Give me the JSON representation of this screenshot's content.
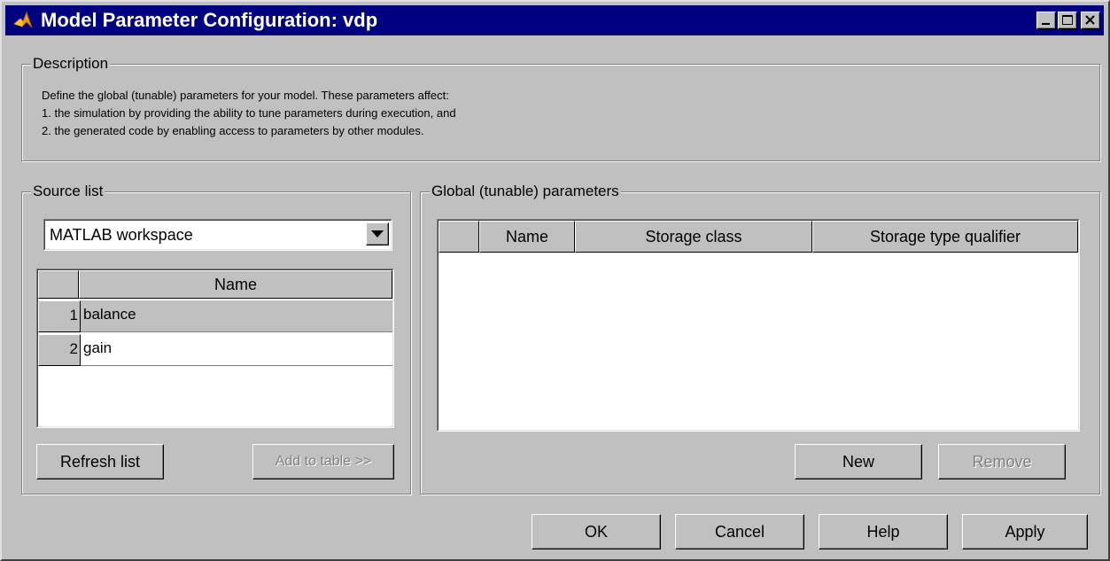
{
  "window": {
    "title": "Model Parameter Configuration: vdp"
  },
  "description": {
    "legend": "Description",
    "lines": [
      "Define the global (tunable) parameters for your model. These parameters affect:",
      "1. the simulation by providing the ability to tune parameters during execution, and",
      "2. the generated code by enabling access to parameters by other modules."
    ]
  },
  "source_list": {
    "legend": "Source list",
    "selected_source": "MATLAB workspace",
    "table": {
      "column_header": "Name",
      "rows": [
        {
          "index": "1",
          "name": "balance"
        },
        {
          "index": "2",
          "name": "gain"
        }
      ]
    },
    "refresh_label": "Refresh list",
    "add_label": "Add to table >>"
  },
  "global_params": {
    "legend": "Global (tunable) parameters",
    "columns": [
      "Name",
      "Storage class",
      "Storage type qualifier"
    ],
    "new_label": "New",
    "remove_label": "Remove"
  },
  "footer": {
    "ok_label": "OK",
    "cancel_label": "Cancel",
    "help_label": "Help",
    "apply_label": "Apply"
  },
  "colors": {
    "titlebar": "#000080",
    "face": "#c0c0c0",
    "selected_row": "#c0c0c0"
  }
}
